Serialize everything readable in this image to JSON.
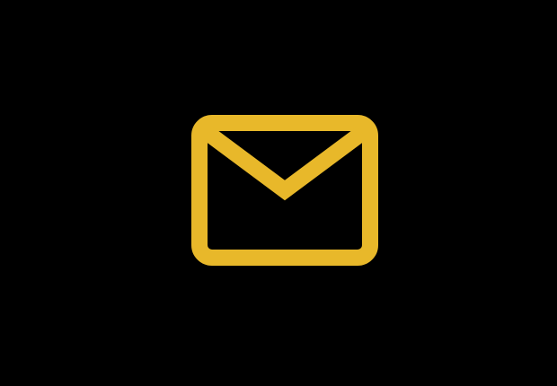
{
  "canvas": {
    "background_color": "#000000"
  },
  "icon": {
    "name": "mail-icon",
    "color": "#E8B82A"
  }
}
